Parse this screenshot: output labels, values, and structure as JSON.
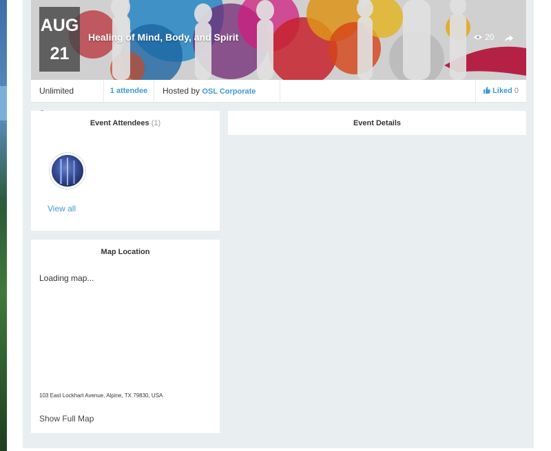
{
  "event": {
    "month": "AUG",
    "day": "21",
    "title": "Healing of Mind, Body, and Spirit",
    "views": "20"
  },
  "info_bar": {
    "seats": "Unlimited Seats",
    "attendees_link": "1 attendee",
    "hosted_by_label": "Hosted by",
    "host_name": "OSL Corporate Office",
    "liked_label": "Liked",
    "liked_count": "0"
  },
  "attendees_panel": {
    "title": "Event Attendees",
    "count": "(1)",
    "view_all": "View all"
  },
  "details_panel": {
    "title": "Event Details"
  },
  "map_panel": {
    "title": "Map Location",
    "loading": "Loading map...",
    "address": "103 East Lockhart Avenue, Alpine, TX 79830, USA",
    "show_full_map": "Show Full Map"
  },
  "colors": {
    "accent": "#3d9ad1",
    "page_background": "#e9eef0"
  },
  "icons": {
    "views": "eye-icon",
    "share": "share-icon",
    "like": "thumbs-up-icon"
  }
}
